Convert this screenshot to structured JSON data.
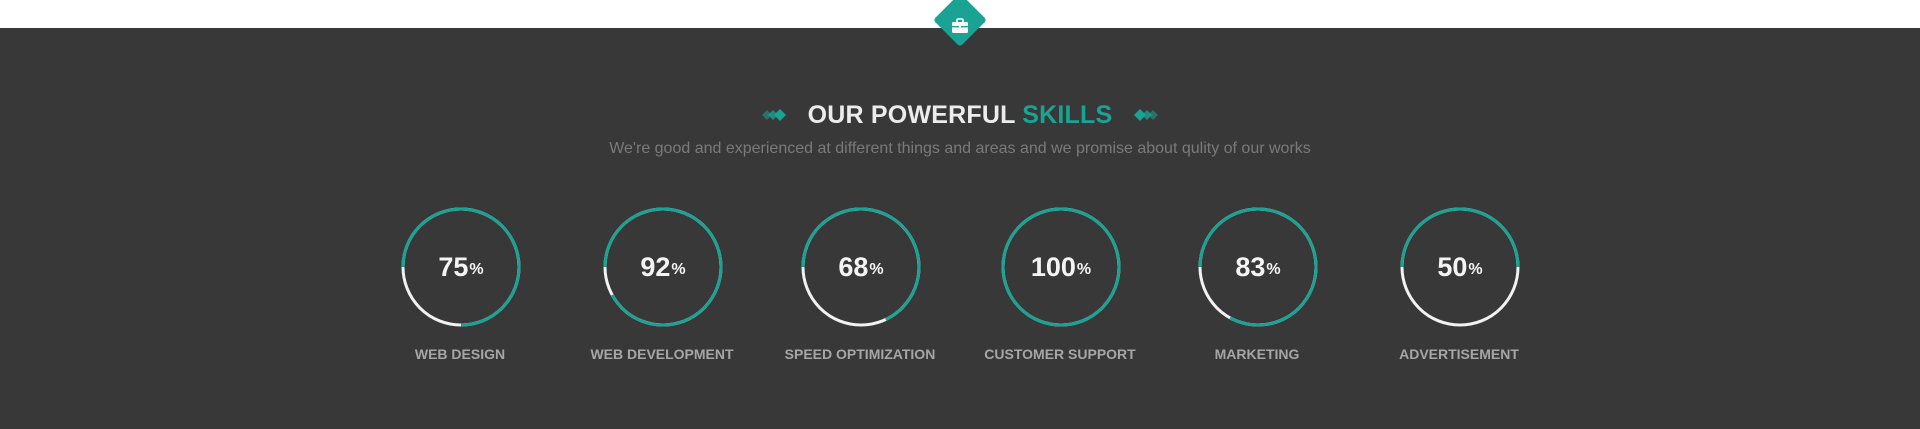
{
  "section": {
    "heading_main": "OUR POWERFUL",
    "heading_accent": "SKILLS",
    "subtitle": "We're good and experienced at different things and areas and we promise about qulity of our works"
  },
  "colors": {
    "accent": "#1aa394",
    "background": "#383838",
    "ring_track": "#f2f2f2",
    "label": "#a6a6a6",
    "subtitle": "#7a7a7a"
  },
  "icons": {
    "badge": "briefcase-icon",
    "ornament": "double-diamond-icon"
  },
  "skills": [
    {
      "label": "WEB DESIGN",
      "value": "75",
      "unit": "%",
      "percent": 75
    },
    {
      "label": "WEB DEVELOPMENT",
      "value": "92",
      "unit": "%",
      "percent": 92
    },
    {
      "label": "SPEED OPTIMIZATION",
      "value": "68",
      "unit": "%",
      "percent": 68
    },
    {
      "label": "CUSTOMER SUPPORT",
      "value": "100",
      "unit": "%",
      "percent": 100
    },
    {
      "label": "MARKETING",
      "value": "83",
      "unit": "%",
      "percent": 83
    },
    {
      "label": "ADVERTISEMENT",
      "value": "50",
      "unit": "%",
      "percent": 50
    }
  ]
}
